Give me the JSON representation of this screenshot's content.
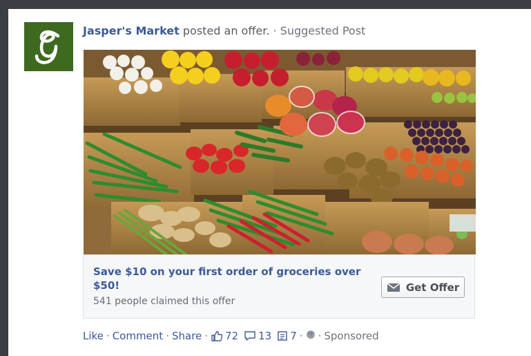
{
  "post": {
    "page_name": "Jasper's Market",
    "action_text": "posted an offer.",
    "suggested_label": "Suggested Post",
    "offer_title": "Save $10 on your first order of groceries over $50!",
    "claims_text": "541 people claimed this offer",
    "button_label": "Get Offer"
  },
  "actions": {
    "like": "Like",
    "comment": "Comment",
    "share": "Share",
    "likes_count": "72",
    "comments_count": "13",
    "shares_count": "7",
    "sponsored": "Sponsored"
  },
  "icons": {
    "avatar": "script-j-logo-icon",
    "get_offer": "mail-icon",
    "like": "thumbs-up-icon",
    "comment": "comment-bubble-icon",
    "share": "share-icon",
    "audience": "globe-icon"
  },
  "colors": {
    "brand_blue": "#3b5998",
    "avatar_green": "#3e6a1f"
  }
}
